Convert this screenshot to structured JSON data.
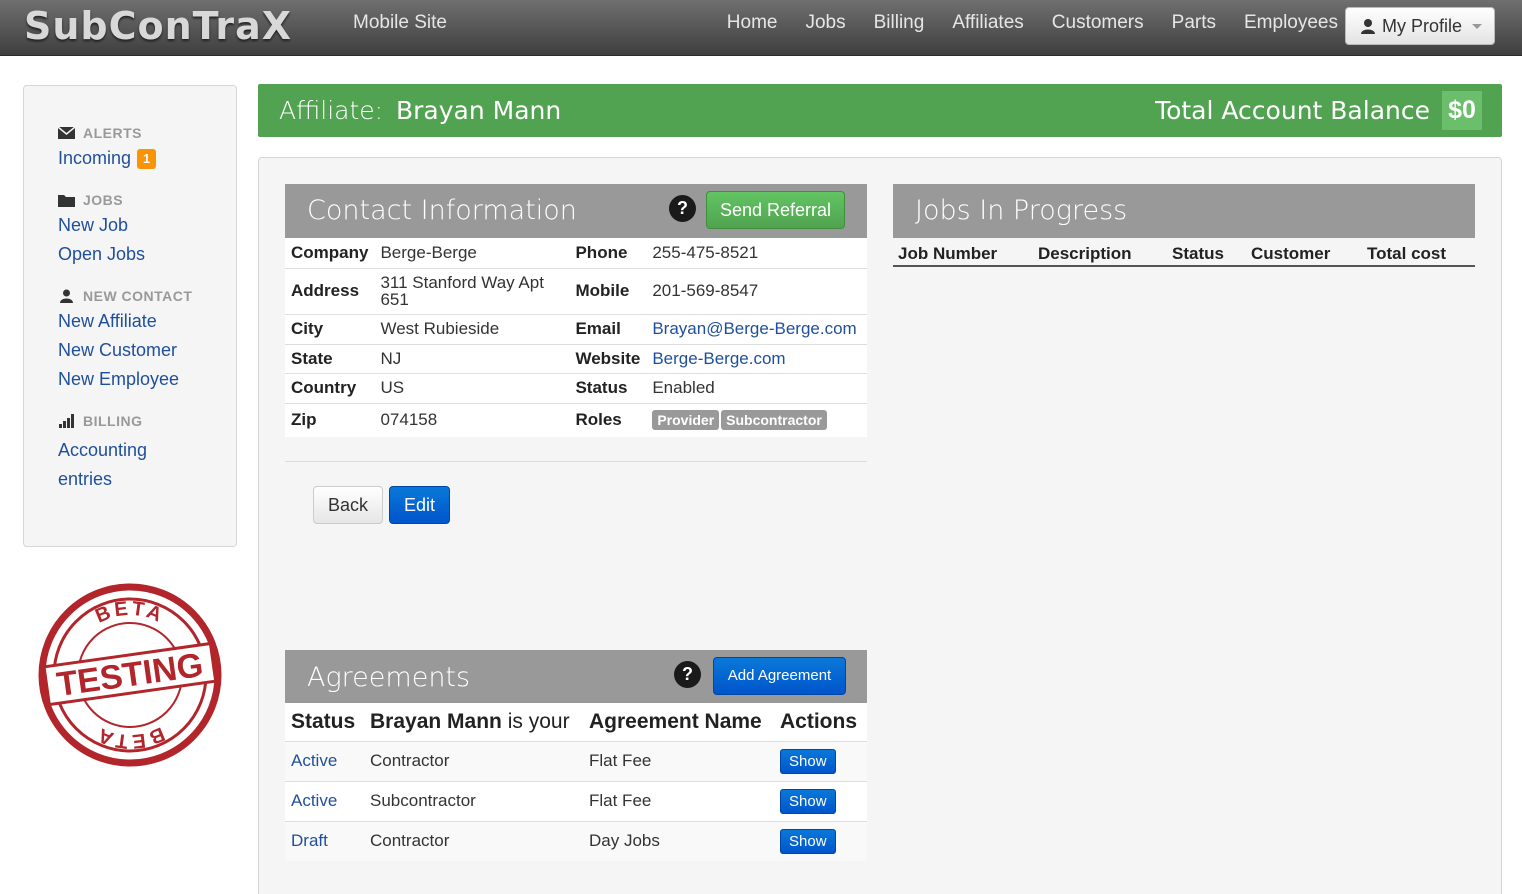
{
  "navbar": {
    "brand": "SubConTraX",
    "mobile_site": "Mobile Site",
    "links": [
      "Home",
      "Jobs",
      "Billing",
      "Affiliates",
      "Customers",
      "Parts",
      "Employees"
    ],
    "profile_label": "My Profile"
  },
  "sidebar": {
    "alerts_header": "ALERTS",
    "incoming_label": "Incoming",
    "incoming_count": "1",
    "jobs_header": "JOBS",
    "new_job": "New Job",
    "open_jobs": "Open Jobs",
    "contact_header": "NEW CONTACT",
    "new_affiliate": "New Affiliate",
    "new_customer": "New Customer",
    "new_employee": "New Employee",
    "billing_header": "BILLING",
    "accounting_line1": "Accounting",
    "accounting_line2": "entries"
  },
  "stamp": {
    "top": "BETA",
    "middle": "TESTING",
    "bottom": "BETA"
  },
  "banner": {
    "label": "Affiliate:",
    "name": "Brayan Mann",
    "balance_label": "Total Account Balance",
    "balance": "$0"
  },
  "contact": {
    "title": "Contact Information",
    "help": "?",
    "send_referral": "Send Referral",
    "rows": [
      {
        "l1": "Company",
        "v1": "Berge-Berge",
        "l2": "Phone",
        "v2": "255-475-8521"
      },
      {
        "l1": "Address",
        "v1": "311 Stanford Way Apt 651",
        "l2": "Mobile",
        "v2": "201-569-8547"
      },
      {
        "l1": "City",
        "v1": "West Rubieside",
        "l2": "Email",
        "v2": "Brayan@Berge-Berge.com"
      },
      {
        "l1": "State",
        "v1": "NJ",
        "l2": "Website",
        "v2": "Berge-Berge.com"
      },
      {
        "l1": "Country",
        "v1": "US",
        "l2": "Status",
        "v2": "Enabled"
      },
      {
        "l1": "Zip",
        "v1": "074158",
        "l2": "Roles",
        "roles": [
          "Provider",
          "Subcontractor"
        ]
      }
    ],
    "back": "Back",
    "edit": "Edit"
  },
  "jobs": {
    "title": "Jobs In Progress",
    "columns": [
      "Job Number",
      "Description",
      "Status",
      "Customer",
      "Total cost"
    ]
  },
  "agreements": {
    "title": "Agreements",
    "help": "?",
    "add_button": "Add Agreement",
    "col_status": "Status",
    "col_name_bold": "Brayan Mann",
    "col_name_rest": "is your",
    "col_agreement": "Agreement Name",
    "col_actions": "Actions",
    "rows": [
      {
        "status": "Active",
        "role": "Contractor",
        "name": "Flat Fee",
        "action": "Show"
      },
      {
        "status": "Active",
        "role": "Subcontractor",
        "name": "Flat Fee",
        "action": "Show"
      },
      {
        "status": "Draft",
        "role": "Contractor",
        "name": "Day Jobs",
        "action": "Show"
      }
    ]
  }
}
